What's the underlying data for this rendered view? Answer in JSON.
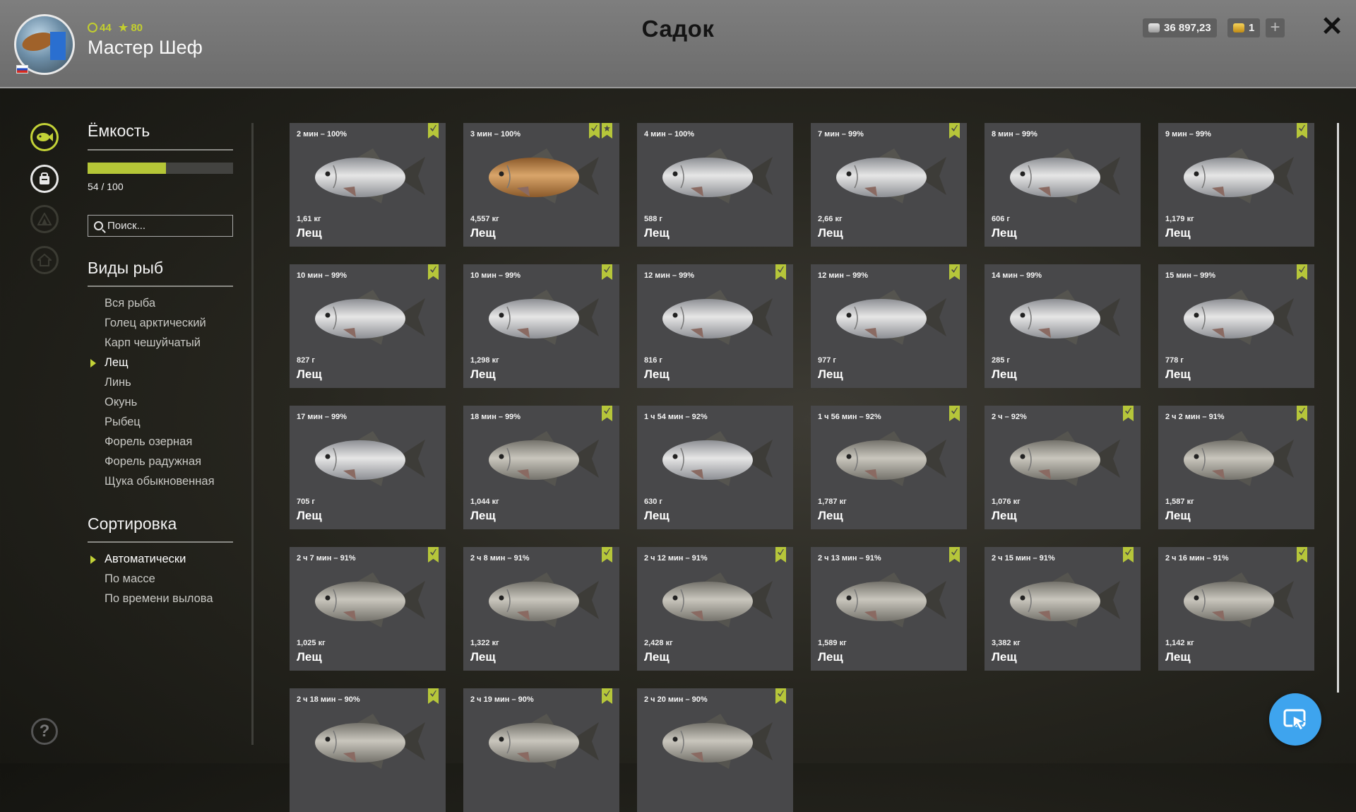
{
  "header": {
    "title": "Садок",
    "username": "Мастер Шеф",
    "level": "44",
    "rank": "80",
    "silver": "36 897,23",
    "gold": "1"
  },
  "capacity": {
    "title": "Ёмкость",
    "label": "54 / 100",
    "fill_fraction": 0.54
  },
  "search": {
    "placeholder": "Поиск..."
  },
  "species": {
    "title": "Виды рыб",
    "items": [
      "Вся рыба",
      "Голец арктический",
      "Карп чешуйчатый",
      "Лещ",
      "Линь",
      "Окунь",
      "Рыбец",
      "Форель озерная",
      "Форель радужная",
      "Щука обыкновенная"
    ],
    "active_index": 3
  },
  "sorting": {
    "title": "Сортировка",
    "items": [
      "Автоматически",
      "По массе",
      "По времени вылова"
    ],
    "active_index": 0
  },
  "colors": {
    "accent": "#c3d237",
    "card_bg": "#48484a",
    "fab": "#3ea4ee"
  },
  "cards": [
    {
      "time": "2 мин – 100%",
      "weight": "1,61 кг",
      "name": "Лещ",
      "badges": [
        "check"
      ],
      "fish": "silver"
    },
    {
      "time": "3 мин – 100%",
      "weight": "4,557 кг",
      "name": "Лещ",
      "badges": [
        "check",
        "star"
      ],
      "fish": "golden"
    },
    {
      "time": "4 мин – 100%",
      "weight": "588 г",
      "name": "Лещ",
      "badges": [],
      "fish": "silver"
    },
    {
      "time": "7 мин – 99%",
      "weight": "2,66 кг",
      "name": "Лещ",
      "badges": [
        "check"
      ],
      "fish": "silver"
    },
    {
      "time": "8 мин – 99%",
      "weight": "606 г",
      "name": "Лещ",
      "badges": [],
      "fish": "silver"
    },
    {
      "time": "9 мин – 99%",
      "weight": "1,179 кг",
      "name": "Лещ",
      "badges": [
        "check"
      ],
      "fish": "silver"
    },
    {
      "time": "10 мин – 99%",
      "weight": "827 г",
      "name": "Лещ",
      "badges": [
        "check"
      ],
      "fish": "silver"
    },
    {
      "time": "10 мин – 99%",
      "weight": "1,298 кг",
      "name": "Лещ",
      "badges": [
        "check"
      ],
      "fish": "silver"
    },
    {
      "time": "12 мин – 99%",
      "weight": "816 г",
      "name": "Лещ",
      "badges": [
        "check"
      ],
      "fish": "silver"
    },
    {
      "time": "12 мин – 99%",
      "weight": "977 г",
      "name": "Лещ",
      "badges": [
        "check"
      ],
      "fish": "silver"
    },
    {
      "time": "14 мин – 99%",
      "weight": "285 г",
      "name": "Лещ",
      "badges": [],
      "fish": "silver"
    },
    {
      "time": "15 мин – 99%",
      "weight": "778 г",
      "name": "Лещ",
      "badges": [
        "check"
      ],
      "fish": "silver"
    },
    {
      "time": "17 мин – 99%",
      "weight": "705 г",
      "name": "Лещ",
      "badges": [],
      "fish": "silver"
    },
    {
      "time": "18 мин – 99%",
      "weight": "1,044 кг",
      "name": "Лещ",
      "badges": [
        "check"
      ],
      "fish": "grey"
    },
    {
      "time": "1 ч 54 мин – 92%",
      "weight": "630 г",
      "name": "Лещ",
      "badges": [],
      "fish": "silver"
    },
    {
      "time": "1 ч 56 мин – 92%",
      "weight": "1,787 кг",
      "name": "Лещ",
      "badges": [
        "check"
      ],
      "fish": "grey"
    },
    {
      "time": "2 ч – 92%",
      "weight": "1,076 кг",
      "name": "Лещ",
      "badges": [
        "check"
      ],
      "fish": "grey"
    },
    {
      "time": "2 ч 2 мин – 91%",
      "weight": "1,587 кг",
      "name": "Лещ",
      "badges": [
        "check"
      ],
      "fish": "grey"
    },
    {
      "time": "2 ч 7 мин – 91%",
      "weight": "1,025 кг",
      "name": "Лещ",
      "badges": [
        "check"
      ],
      "fish": "grey"
    },
    {
      "time": "2 ч 8 мин – 91%",
      "weight": "1,322 кг",
      "name": "Лещ",
      "badges": [
        "check"
      ],
      "fish": "grey"
    },
    {
      "time": "2 ч 12 мин – 91%",
      "weight": "2,428 кг",
      "name": "Лещ",
      "badges": [
        "check"
      ],
      "fish": "grey"
    },
    {
      "time": "2 ч 13 мин – 91%",
      "weight": "1,589 кг",
      "name": "Лещ",
      "badges": [
        "check"
      ],
      "fish": "grey"
    },
    {
      "time": "2 ч 15 мин – 91%",
      "weight": "3,382 кг",
      "name": "Лещ",
      "badges": [
        "check"
      ],
      "fish": "grey"
    },
    {
      "time": "2 ч 16 мин – 91%",
      "weight": "1,142 кг",
      "name": "Лещ",
      "badges": [
        "check"
      ],
      "fish": "grey"
    },
    {
      "time": "2 ч 18 мин – 90%",
      "weight": "",
      "name": "",
      "badges": [
        "check"
      ],
      "fish": "grey"
    },
    {
      "time": "2 ч 19 мин – 90%",
      "weight": "",
      "name": "",
      "badges": [
        "check"
      ],
      "fish": "grey"
    },
    {
      "time": "2 ч 20 мин – 90%",
      "weight": "",
      "name": "",
      "badges": [
        "check"
      ],
      "fish": "grey"
    }
  ]
}
